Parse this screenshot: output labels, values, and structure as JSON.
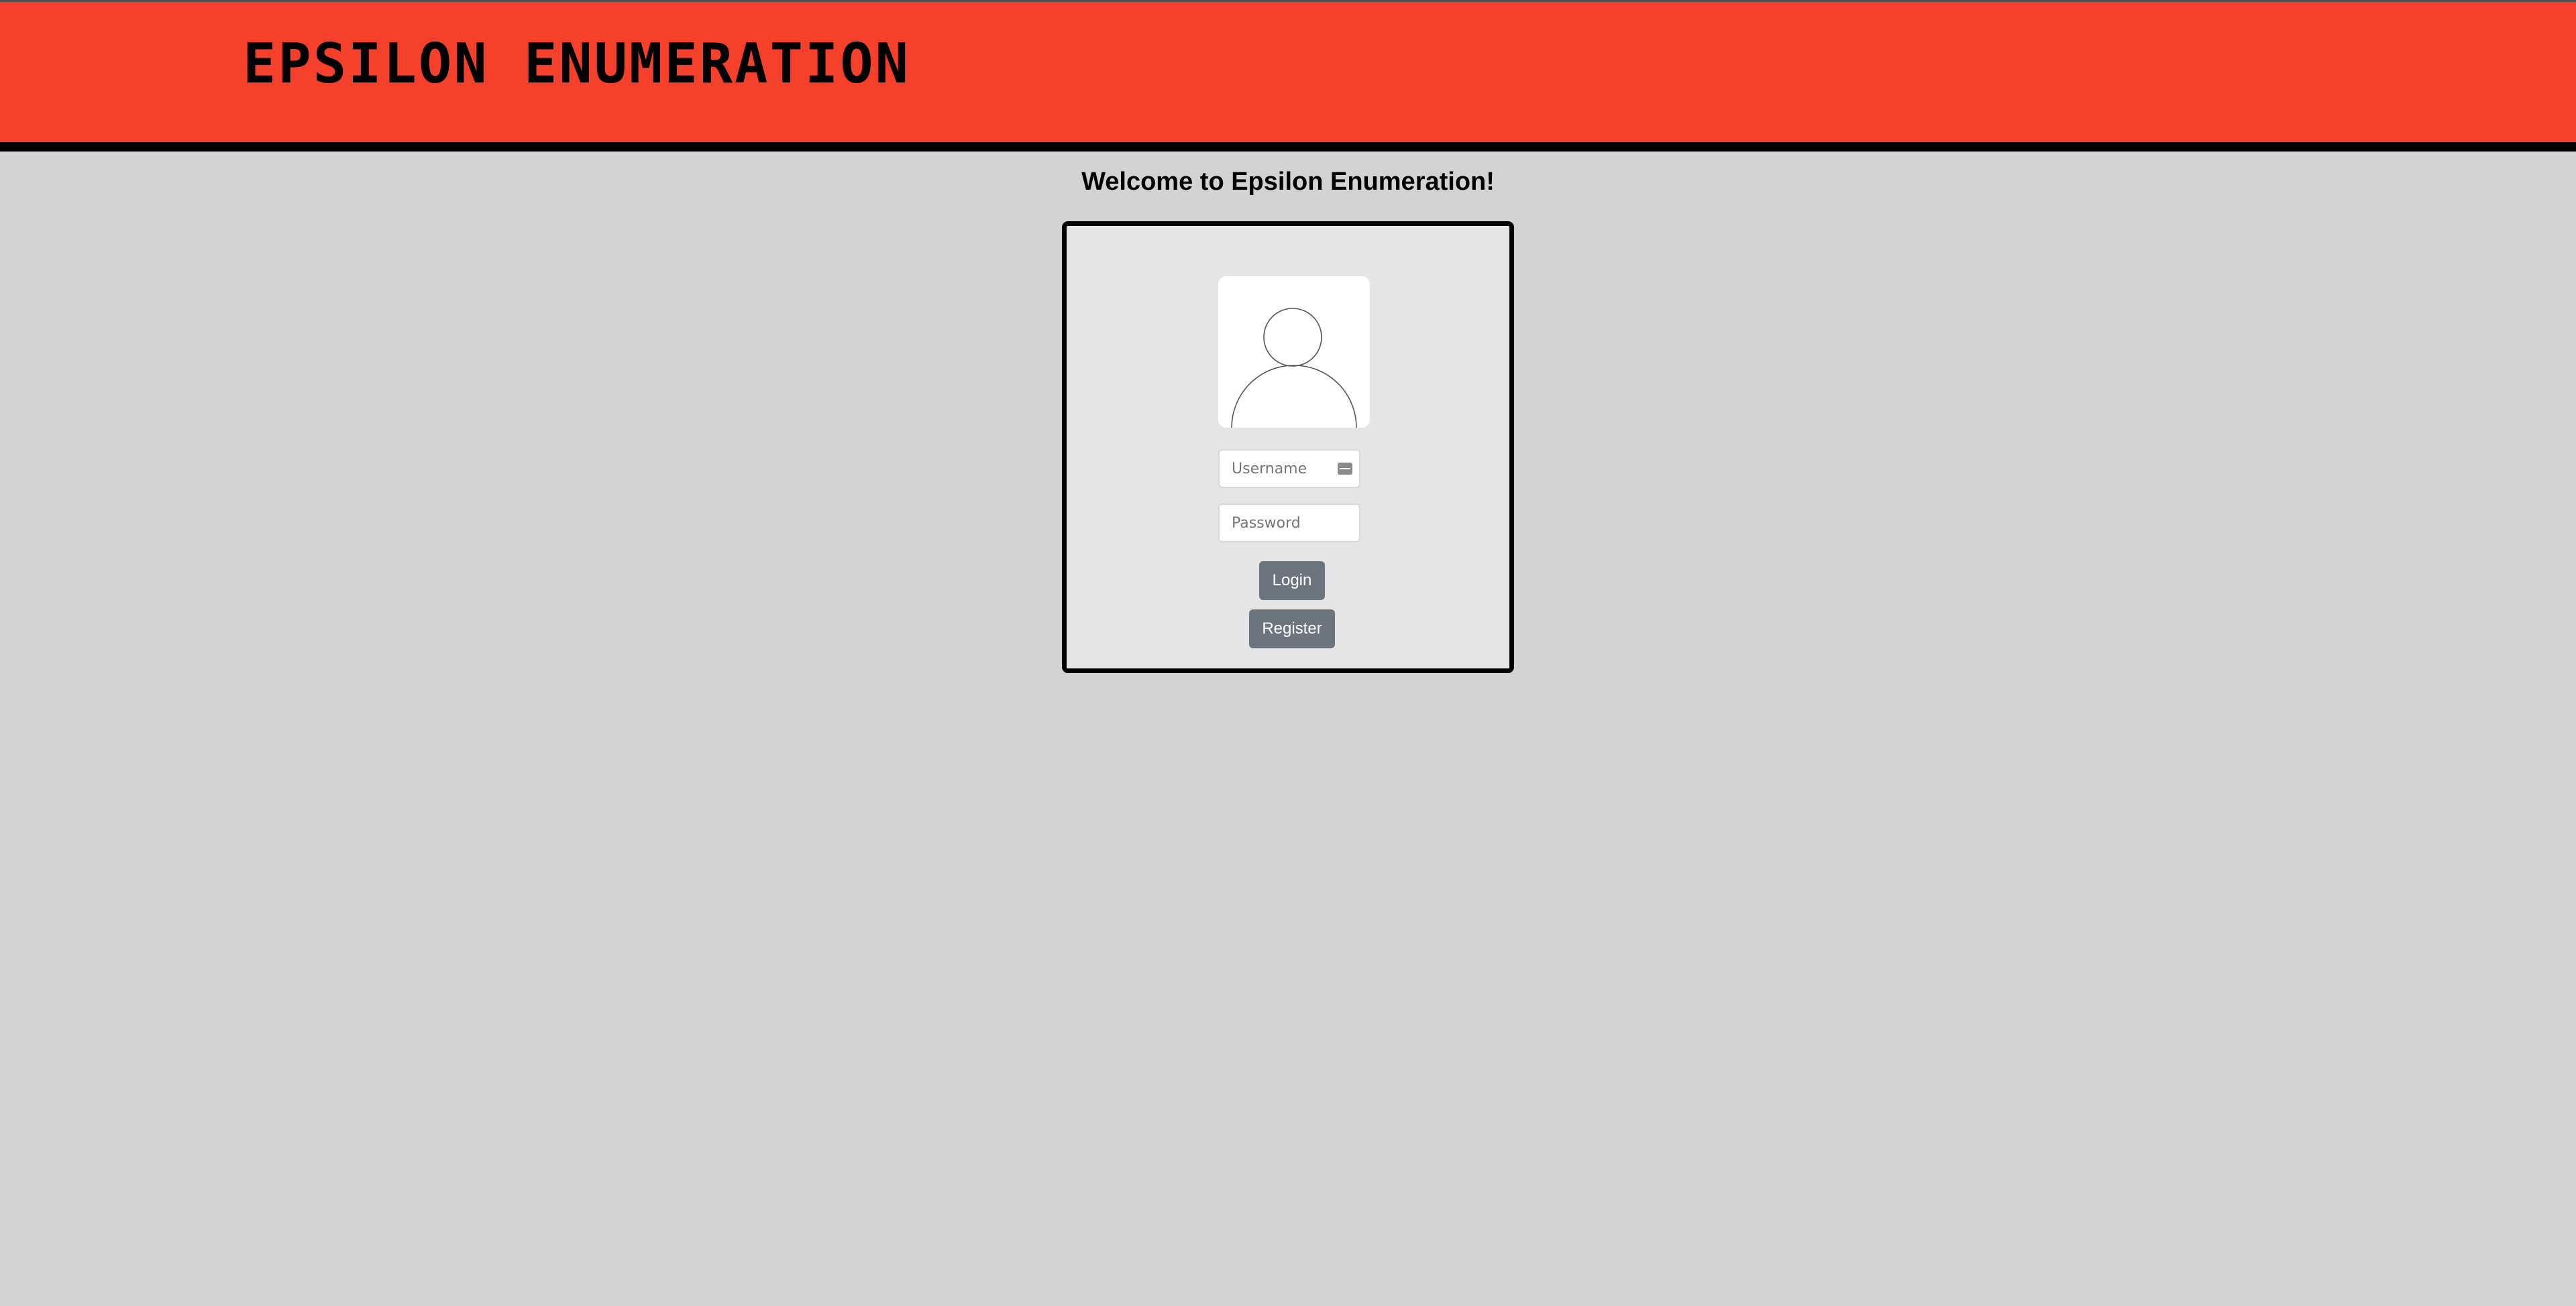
{
  "header": {
    "title": "EPSILON ENUMERATION",
    "background_color": "#f5402c"
  },
  "main": {
    "welcome_text": "Welcome to Epsilon Enumeration!"
  },
  "login_form": {
    "avatar_icon": "user-avatar-icon",
    "username": {
      "placeholder": "Username",
      "value": ""
    },
    "password": {
      "placeholder": "Password",
      "value": ""
    },
    "autofill_icon": "autofill-card-icon",
    "login_label": "Login",
    "register_label": "Register",
    "button_color": "#6c757d"
  }
}
